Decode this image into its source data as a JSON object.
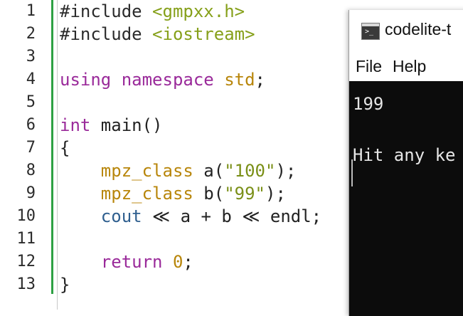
{
  "editor": {
    "line_numbers": [
      "1",
      "2",
      "3",
      "4",
      "5",
      "6",
      "7",
      "8",
      "9",
      "10",
      "11",
      "12",
      "13"
    ],
    "lines": {
      "l1": {
        "a": "#include ",
        "b": "<gmpxx.h>"
      },
      "l2": {
        "a": "#include ",
        "b": "<iostream>"
      },
      "l4": {
        "a": "using namespace ",
        "b": "std",
        ";": ";"
      },
      "l6": {
        "a": "int",
        "b": " main()"
      },
      "l7": {
        "a": "{"
      },
      "l8": {
        "a": "    ",
        "t": "mpz_class",
        "r": " a(",
        "s": "\"100\"",
        "e": ");"
      },
      "l9": {
        "a": "    ",
        "t": "mpz_class",
        "r": " b(",
        "s": "\"99\"",
        "e": ");"
      },
      "l10": {
        "a": "    ",
        "c": "cout",
        "r": " ≪ a + b ≪ endl;"
      },
      "l12": {
        "a": "    ",
        "k": "return",
        "sp": " ",
        "n": "0",
        "e": ";"
      },
      "l13": {
        "a": "}"
      }
    }
  },
  "terminal": {
    "title": "codelite-t",
    "menu": [
      "File",
      "Help"
    ],
    "output": [
      "199",
      "",
      "Hit any ke"
    ]
  }
}
